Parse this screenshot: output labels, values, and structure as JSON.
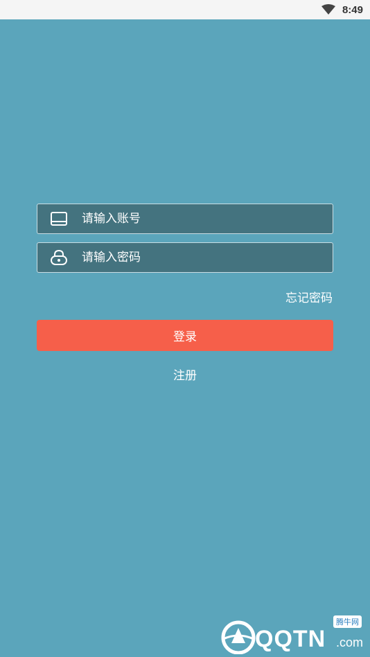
{
  "status_bar": {
    "time": "8:49",
    "icons": [
      "wifi-icon"
    ]
  },
  "login_form": {
    "account_placeholder": "请输入账号",
    "password_placeholder": "请输入密码",
    "forgot_password": "忘记密码",
    "login_label": "登录",
    "register_label": "注册"
  },
  "watermark": {
    "brand": "QQTN",
    "domain": ".com",
    "badge": "腾牛网"
  },
  "colors": {
    "background": "#5ba5bb",
    "field_bg": "#44737f",
    "login_button": "#f65f4a"
  }
}
